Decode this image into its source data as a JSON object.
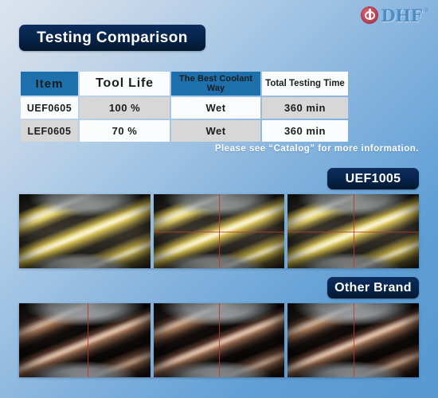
{
  "brand": {
    "logo_text": "DHF",
    "logo_tm": "®",
    "logo_icon": "dhf-circle-mark"
  },
  "header": {
    "title": "Testing Comparison"
  },
  "table": {
    "columns": [
      "Item",
      "Tool Life",
      "The Best Coolant Way",
      "Total Testing Time"
    ],
    "rows": [
      {
        "item": "UEF0605",
        "tool_life": "100 %",
        "coolant": "Wet",
        "testing_time": "360 min"
      },
      {
        "item": "LEF0605",
        "tool_life": "70 %",
        "coolant": "Wet",
        "testing_time": "360 min"
      }
    ]
  },
  "note": "Please see  “Catalog” for more information.",
  "sections": [
    {
      "label": "UEF1005",
      "photo_count": 3,
      "style": "gold"
    },
    {
      "label": "Other Brand",
      "photo_count": 3,
      "style": "dark"
    }
  ],
  "colors": {
    "badge_navy": "#062349",
    "header_blue": "#1d70ab",
    "cell_light": "#fafcfd",
    "cell_dark": "#d7d7d7",
    "bg_top": "#dce5ee",
    "bg_bottom": "#5899d1",
    "logo_blue": "#4f8ec4",
    "logo_red": "#c1485a",
    "crosshair_red": "#c2342f"
  }
}
